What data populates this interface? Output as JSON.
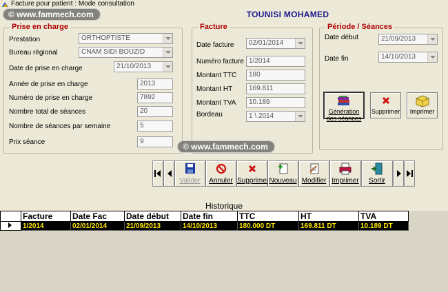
{
  "window": {
    "title": "Facture pour patient  : Mode consultation"
  },
  "watermark": "© www.fammech.com",
  "header": {
    "patient_name": "TOUNISI MOHAMED"
  },
  "prise": {
    "title": "Prise en charge",
    "prestation_label": "Prestation",
    "prestation_value": "ORTHOPTISTE",
    "bureau_label": "Bureau régional",
    "bureau_value": "CNAM SIDI BOUZID",
    "date_label": "Date de prise en charge",
    "date_value": "21/10/2013",
    "annee_label": "Année de prise en charge",
    "annee_value": "2013",
    "numero_label": "Numéro de prise en charge",
    "numero_value": "7892",
    "total_label": "Nombre total de séances",
    "total_value": "20",
    "semaine_label": "Nombre de séances par semaine",
    "semaine_value": "5",
    "prix_label": "Prix séance",
    "prix_value": "9"
  },
  "facture": {
    "title": "Facture",
    "date_label": "Date facture",
    "date_value": "02/01/2014",
    "numero_label": "Numéro facture",
    "numero_value": "1/2014",
    "ttc_label": "Montant TTC",
    "ttc_value": "180",
    "ht_label": "Montant HT",
    "ht_value": "169.811",
    "tva_label": "Montant TVA",
    "tva_value": "10.189",
    "bordeau_label": "Bordeau",
    "bordeau_value": "1 \\ 2014"
  },
  "periode": {
    "title": "Période / Séances",
    "debut_label": "Date début",
    "debut_value": "21/09/2013",
    "fin_label": "Date fin",
    "fin_value": "14/10/2013",
    "generation_label": "Génération des séances",
    "supprimer_label": "Supprimer",
    "imprimer_label": "Imprimer"
  },
  "toolbar": {
    "valider": "Valider",
    "annuler": "Annuler",
    "supprimer": "Supprimer",
    "nouveau": "Nouveau",
    "modifier": "Modifier",
    "imprimer": "Imprimer",
    "sortir": "Sortir"
  },
  "historique": {
    "title": "Historique",
    "columns": [
      "Facture",
      "Date Fac",
      "Date début",
      "Date fin",
      "TTC",
      "HT",
      "TVA"
    ],
    "rows": [
      [
        "1/2014",
        "02/01/2014",
        "21/09/2013",
        "14/10/2013",
        "180.000 DT",
        "169.811 DT",
        "10.189 DT"
      ]
    ]
  },
  "colors": {
    "background": "#ece9d8",
    "group_title": "#b00000",
    "name": "#1a1a8c",
    "row_bg": "#000000",
    "row_text": "#ffe600"
  }
}
